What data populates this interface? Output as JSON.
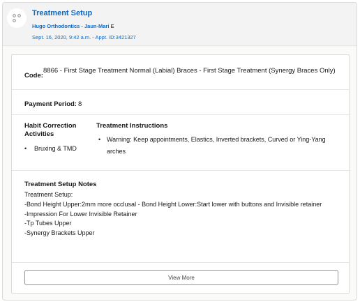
{
  "header": {
    "avatar_icon": "treatment-icon",
    "title": "Treatment Setup",
    "subtitle": "Hugo Orthodontics - Jaun-Mari E",
    "meta": "Sept. 16, 2020, 9:42 a.m. - Appt. ID:3421327"
  },
  "code": {
    "label": "Code:",
    "value": "8866 - First Stage Treatment Normal (Labial) Braces - First Stage Treatment (Synergy Braces Only)"
  },
  "payment": {
    "label": "Payment Period:",
    "value": "8"
  },
  "habit": {
    "title": "Habit Correction Activities",
    "items": [
      "Bruxing & TMD"
    ]
  },
  "instructions": {
    "title": "Treatment Instructions",
    "items": [
      "Warning: Keep appointments, Elastics, Inverted brackets, Curved or Ying-Yang arches"
    ]
  },
  "notes": {
    "title": "Treatment Setup Notes",
    "lines": [
      "Treatment Setup:",
      "-Bond Height Upper:2mm more occlusal - Bond Height Lower:Start lower with buttons and Invisible retainer",
      "-Impression For Lower Invisible Retainer",
      "-Tp Tubes Upper",
      "-Synergy Brackets Upper"
    ]
  },
  "actions": {
    "view_more": "View More"
  },
  "colors": {
    "accent": "#0b6bc7",
    "header_bg": "#f3f3f3",
    "border": "#dddbda"
  }
}
